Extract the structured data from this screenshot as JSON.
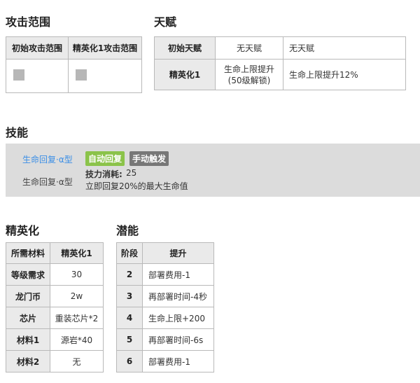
{
  "attack_range": {
    "heading": "攻击范围",
    "headers": [
      "初始攻击范围",
      "精英化1攻击范围"
    ]
  },
  "talent": {
    "heading": "天赋",
    "rows": [
      [
        "初始天赋",
        "无天赋",
        "无天赋"
      ],
      [
        "精英化1",
        "生命上限提升\n(50级解锁)",
        "生命上限提升12%"
      ]
    ]
  },
  "skills": {
    "heading": "技能",
    "skill_name_link": "生命回复·α型",
    "skill_name": "生命回复·α型",
    "tag_auto": "自动回复",
    "tag_manual": "手动触发",
    "cost_label": "技力消耗:",
    "cost_value": "25",
    "description": "立即回复20%的最大生命值",
    "colors": {
      "link": "#3a8ee6",
      "tag_auto": "#8bc34a",
      "tag_manual": "#777777"
    }
  },
  "elite": {
    "heading": "精英化",
    "headers": [
      "所需材料",
      "精英化1"
    ],
    "rows": [
      [
        "等级需求",
        "30"
      ],
      [
        "龙门币",
        "2w"
      ],
      [
        "芯片",
        "重装芯片*2"
      ],
      [
        "材料1",
        "源岩*40"
      ],
      [
        "材料2",
        "无"
      ]
    ]
  },
  "potential": {
    "heading": "潜能",
    "headers": [
      "阶段",
      "提升"
    ],
    "rows": [
      [
        "2",
        "部署费用-1"
      ],
      [
        "3",
        "再部署时间-4秒"
      ],
      [
        "4",
        "生命上限+200"
      ],
      [
        "5",
        "再部署时间-6s"
      ],
      [
        "6",
        "部署费用-1"
      ]
    ]
  }
}
